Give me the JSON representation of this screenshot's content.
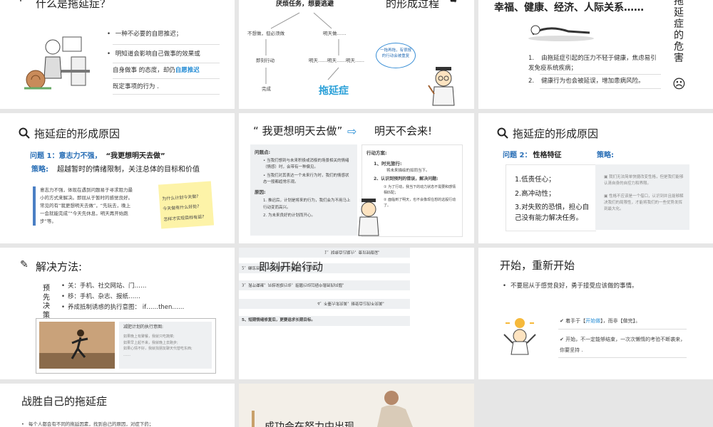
{
  "s1": {
    "title": "什么是拖延症？",
    "b1": "一种不必要的自愿推迟；",
    "b2a": "明知道会影响自己做事的效果或",
    "b2b_pre": "自身做事 的态度，却仍",
    "b2b_hl": "自愿推迟",
    "b2c": "既定事项的行为 ."
  },
  "s2": {
    "top": "厌烦任务，想要逃避",
    "title": "的形成过程",
    "left1": "不想做，但必须做",
    "right1": "明天做……",
    "left2": "即刻行动",
    "right2": "明天……明天……明天……",
    "left3": "完成",
    "result": "拖延症",
    "bubble": "一拖再拖，有很报的行动会被重复"
  },
  "s3": {
    "title": "幸福、健康、经济、人际关系……",
    "side": "拖延症的危害",
    "n1": "由拖延症引起的压力不轻于健康，焦虑易引发免疫系统疾病；",
    "n2": "健康行为也会被延误，增加患病风险。",
    "face": "☹"
  },
  "s4": {
    "title": "拖延症的形成原因",
    "q": "问题 1：意志力不强，",
    "q2": "“我更想明天去做”",
    "strategy_label": "策略:",
    "strategy": "超越暂时的情绪限制，关注总体的目标和价值",
    "body": "意志力不强，体现在遇到问题易于寻求阻力最小的方式来解决。即屈从于暂时的感觉良好。常见的有“我更想明天去做”，“先玩去，晚上一会就能完成”“今天先休息，明天再开始跑步”等。",
    "note1": "为什么计划今天做?",
    "note2": "今天做有什么好处?",
    "note3": "怎样才实现目标有益?"
  },
  "s5": {
    "quote": "“ 我更想明天去做”",
    "result": "明天不会来!",
    "prob_title": "问题点:",
    "prob1": "当我们想到与未来积极或消极的场景相关的情绪（情感）时，会带有一种偏见。",
    "prob2": "当我们对其表达一个未来行为时，我们的情感状态一般都趋常乐观。",
    "cause_title": "原因:",
    "cause1": "推迟后，计划是将来的行为，我们会为不用马上行动变而高兴。",
    "cause2": "为未来良好的计划而开心。",
    "act_title": "行动方案:",
    "act1": "1、时光旅行:",
    "act1d": "将未来描绘的如同当下。",
    "act2": "2、认识到预判的错误，解决问题:",
    "act2a": "为了行动，我当下的动力状态不需要和感情相匹配；",
    "act2b": "面临到了明天，也不会像现在想的这般行动了。"
  },
  "s6": {
    "title": "拖延症的形成原因",
    "q": "问题 2：",
    "q2": "性格特征",
    "strategy_label": "策略:",
    "l1": "1.低责任心；",
    "l2": "2.高冲动性；",
    "l3": "3.对失败的恐惧，担心自己没有能力解决任务。",
    "r1": "我们无法简单快捷改变性格，但是我们能够认清自身的自控力和界限。",
    "r2": "性格不应该是一个借口，认识到并且能够解决我们的局限性，才能将我们的一些优势发挥到最大化。"
  },
  "s7": {
    "title": "解决方法:",
    "vert": "预先决策",
    "b1": "关：手机、社交网站、门……",
    "b2": "移：手机、杂志、报纸……",
    "b3": "养成抵制诱惑的执行意图：  if……then……",
    "box_title": "减肥计划的执行意图:",
    "box1": "如果晚上有聚餐，我就只吃蔬菜;",
    "box2": "如果早上起不来，我就晚上去跑步;",
    "box3": "如果心情不好，我就找朋友聊天代替吃东西;",
    "box4": "……"
  },
  "s8": {
    "title": "即刻开始行动",
    "l1": "1、知晓自己能力，意识到错误。",
    "l2": "2、确定目标，不是逃避，不懒惰，不拖延。",
    "l3": "3、调节情绪，开始采取行动，把握行动过程中遇到的问题。",
    "l4": "4、不要力求完美，接受自己的不完美。",
    "l5": "5、短期情绪修复后，更要追求长期目标。"
  },
  "s9": {
    "title": "开始，重新开始",
    "b1": "不要屈从于感觉良好，勇于接受应该做的事情。",
    "c1_pre": "着手于【",
    "c1_hl": "开始做",
    "c1_mid": "】，而非【",
    "c1_end": "做完】。",
    "c2": "开始，不一定能够结束，一次次懒惰的考验不断袭来，你要坚持 ."
  },
  "s10": {
    "title": "战胜自己的拖延症",
    "b1": "每个人都会有不同的拖延因素，找到自己的原因，对症下药；"
  },
  "s11": {
    "title": "成功会在努力中出现"
  }
}
